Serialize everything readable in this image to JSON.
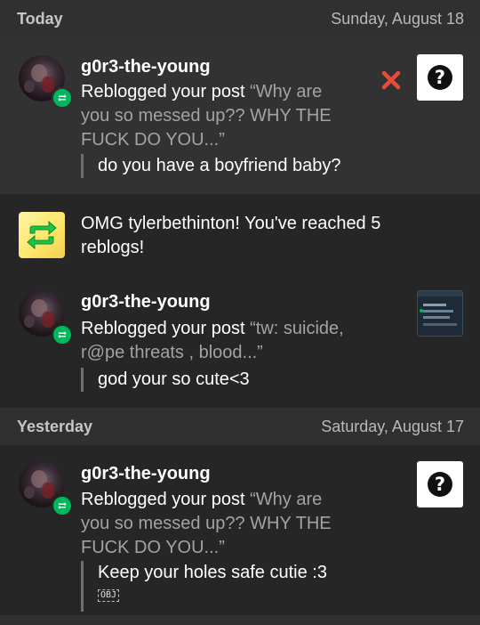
{
  "sections": {
    "today": {
      "label": "Today",
      "date": "Sunday, August 18"
    },
    "yesterday": {
      "label": "Yesterday",
      "date": "Saturday, August 17"
    }
  },
  "notifications": {
    "n1": {
      "username": "g0r3-the-young",
      "action": "Reblogged your post ",
      "quote": "“Why are you so messed up?? WHY THE FUCK DO YOU...”",
      "reply": "do you have a boyfriend baby?",
      "icon": "question-mark-icon",
      "dismiss_icon": "close-icon"
    },
    "n2": {
      "text": "OMG tylerbethinton! You've reached 5 reblogs!",
      "icon": "reblog-milestone-icon"
    },
    "n3": {
      "username": "g0r3-the-young",
      "action": "Reblogged your post ",
      "quote": "“tw: suicide, r@pe threats , blood...”",
      "reply": "god your so cute<3"
    },
    "n4": {
      "username": "g0r3-the-young",
      "action": "Reblogged your post ",
      "quote": "“Why are you so messed up?? WHY THE FUCK DO YOU...”",
      "reply": "Keep your holes safe cutie :3",
      "obj": "OBJ",
      "icon": "question-mark-icon"
    }
  },
  "colors": {
    "background": "#262626",
    "header": "#303030",
    "highlight": "#323232",
    "reblog_green": "#00b85c",
    "dismiss_red": "#e84a3c"
  }
}
